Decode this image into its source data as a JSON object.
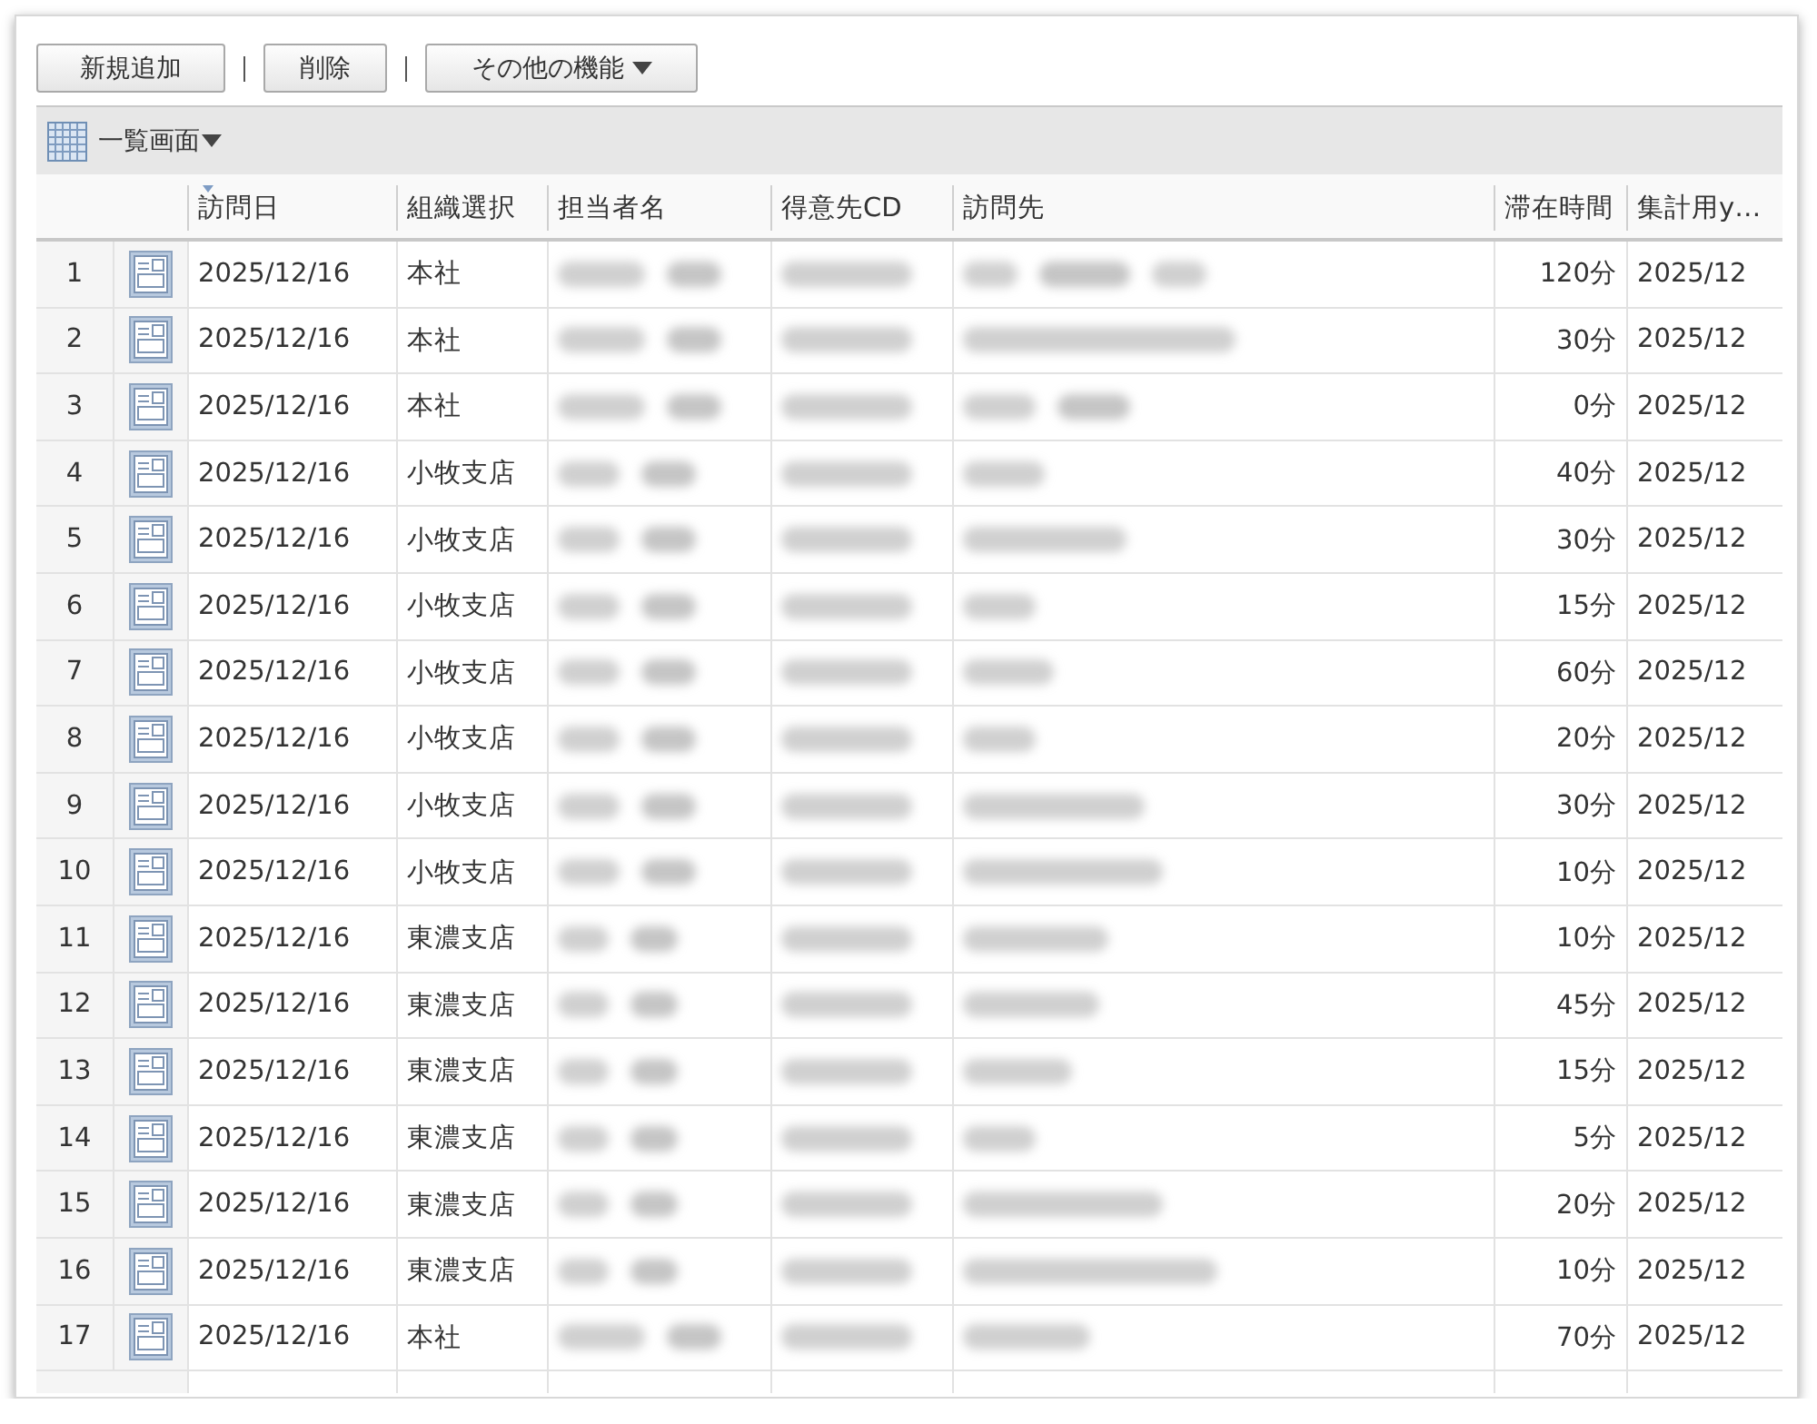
{
  "toolbar": {
    "buttons": [
      {
        "label": "新規追加",
        "kind": "plain"
      },
      {
        "label": "削除",
        "kind": "plain"
      },
      {
        "label": "その他の機能",
        "kind": "dropdown"
      }
    ]
  },
  "view": {
    "label": "一覧画面"
  },
  "table": {
    "columns": [
      {
        "kind": "date",
        "label": "訪問日",
        "sorted": true
      },
      {
        "kind": "organization",
        "label": "組織選択",
        "sorted": false
      },
      {
        "kind": "hidden",
        "label": "担当者名",
        "sorted": false
      },
      {
        "kind": "hidden",
        "label": "得意先CD",
        "sorted": false
      },
      {
        "kind": "hidden",
        "label": "訪問先",
        "sorted": false
      },
      {
        "kind": "stay",
        "label": "滞在時間",
        "sorted": false
      },
      {
        "kind": "aggregation",
        "label": "集計用y…",
        "sorted": false
      }
    ],
    "rows": [
      {
        "number": "1",
        "date": "2025/12/16",
        "organization": "本社",
        "stay": "120分",
        "aggregation": "2025/12"
      },
      {
        "number": "2",
        "date": "2025/12/16",
        "organization": "本社",
        "stay": "30分",
        "aggregation": "2025/12"
      },
      {
        "number": "3",
        "date": "2025/12/16",
        "organization": "本社",
        "stay": "0分",
        "aggregation": "2025/12"
      },
      {
        "number": "4",
        "date": "2025/12/16",
        "organization": "小牧支店",
        "stay": "40分",
        "aggregation": "2025/12"
      },
      {
        "number": "5",
        "date": "2025/12/16",
        "organization": "小牧支店",
        "stay": "30分",
        "aggregation": "2025/12"
      },
      {
        "number": "6",
        "date": "2025/12/16",
        "organization": "小牧支店",
        "stay": "15分",
        "aggregation": "2025/12"
      },
      {
        "number": "7",
        "date": "2025/12/16",
        "organization": "小牧支店",
        "stay": "60分",
        "aggregation": "2025/12"
      },
      {
        "number": "8",
        "date": "2025/12/16",
        "organization": "小牧支店",
        "stay": "20分",
        "aggregation": "2025/12"
      },
      {
        "number": "9",
        "date": "2025/12/16",
        "organization": "小牧支店",
        "stay": "30分",
        "aggregation": "2025/12"
      },
      {
        "number": "10",
        "date": "2025/12/16",
        "organization": "小牧支店",
        "stay": "10分",
        "aggregation": "2025/12"
      },
      {
        "number": "11",
        "date": "2025/12/16",
        "organization": "東濃支店",
        "stay": "10分",
        "aggregation": "2025/12"
      },
      {
        "number": "12",
        "date": "2025/12/16",
        "organization": "東濃支店",
        "stay": "45分",
        "aggregation": "2025/12"
      },
      {
        "number": "13",
        "date": "2025/12/16",
        "organization": "東濃支店",
        "stay": "15分",
        "aggregation": "2025/12"
      },
      {
        "number": "14",
        "date": "2025/12/16",
        "organization": "東濃支店",
        "stay": "5分",
        "aggregation": "2025/12"
      },
      {
        "number": "15",
        "date": "2025/12/16",
        "organization": "東濃支店",
        "stay": "20分",
        "aggregation": "2025/12"
      },
      {
        "number": "16",
        "date": "2025/12/16",
        "organization": "東濃支店",
        "stay": "10分",
        "aggregation": "2025/12"
      },
      {
        "number": "17",
        "date": "2025/12/16",
        "organization": "本社",
        "stay": "70分",
        "aggregation": "2025/12"
      }
    ]
  }
}
